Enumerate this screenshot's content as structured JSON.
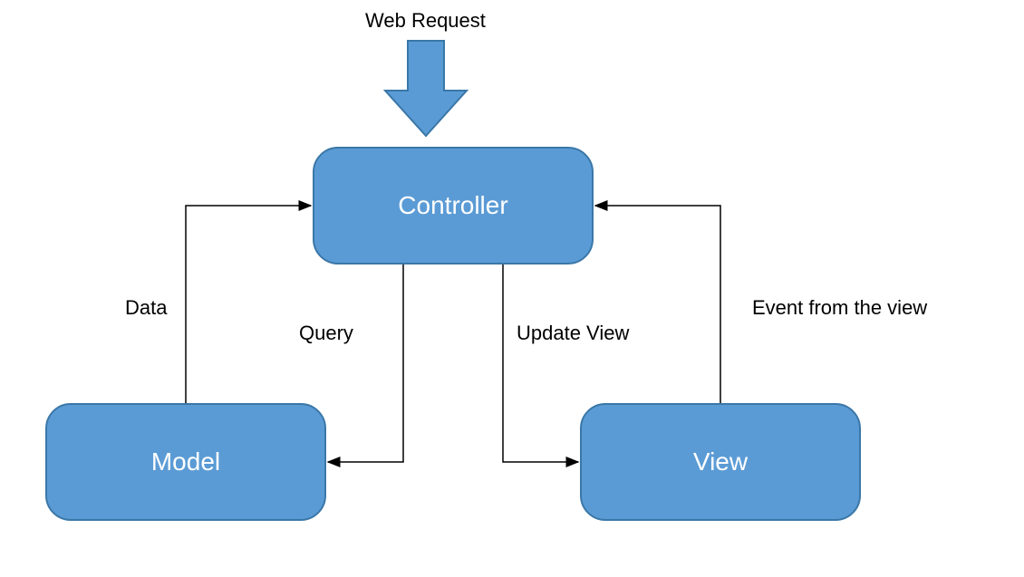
{
  "diagram": {
    "title": "Web Request",
    "nodes": {
      "controller": "Controller",
      "model": "Model",
      "view": "View"
    },
    "edges": {
      "data": "Data",
      "query": "Query",
      "update_view": "Update View",
      "event_from_view": "Event from the view"
    }
  }
}
